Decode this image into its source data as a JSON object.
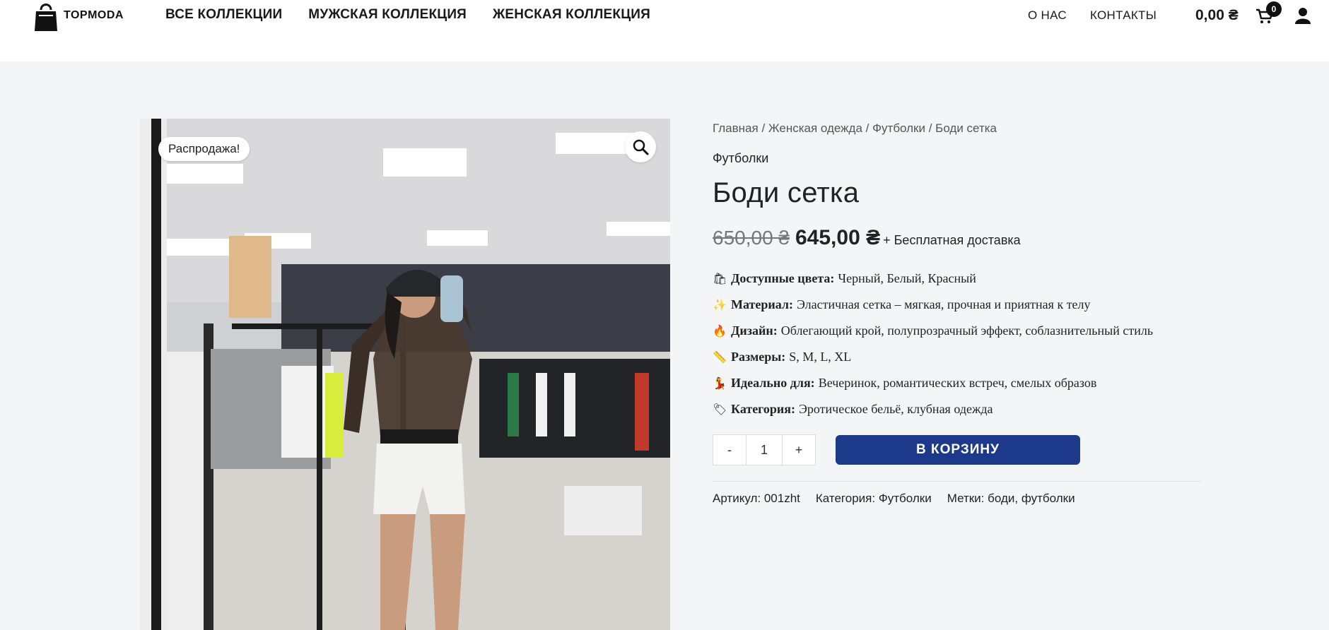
{
  "brand": {
    "name": "TOPMODA"
  },
  "nav": {
    "main": [
      "ВСЕ КОЛЛЕКЦИИ",
      "МУЖСКАЯ КОЛЛЕКЦИЯ",
      "ЖЕНСКАЯ КОЛЛЕКЦИЯ"
    ],
    "right": [
      "О НАС",
      "КОНТАКТЫ"
    ]
  },
  "cart": {
    "total": "0,00 ₴",
    "count": "0"
  },
  "product": {
    "sale_badge": "Распродажа!",
    "breadcrumb": [
      "Главная",
      "Женская одежда",
      "Футболки",
      "Боди сетка"
    ],
    "breadcrumb_sep": " / ",
    "category": "Футболки",
    "title": "Боди сетка",
    "old_price": "650,00 ₴",
    "new_price": "645,00 ₴",
    "shipping": "+ Бесплатная доставка",
    "attributes": [
      {
        "icon": "🛍",
        "label": "Доступные цвета:",
        "value": "Черный, Белый, Красный"
      },
      {
        "icon": "✨",
        "label": "Материал:",
        "value": "Эластичная сетка – мягкая, прочная и приятная к телу"
      },
      {
        "icon": "🔥",
        "label": "Дизайн:",
        "value": "Облегающий крой, полупрозрачный эффект, соблазнительный стиль"
      },
      {
        "icon": "📏",
        "label": "Размеры:",
        "value": "S, M, L, XL"
      },
      {
        "icon": "💃",
        "label": "Идеально для:",
        "value": "Вечеринок, романтических встреч, смелых образов"
      },
      {
        "icon": "🏷",
        "label": "Категория:",
        "value": "Эротическое бельё, клубная одежда"
      }
    ],
    "qty": {
      "minus": "-",
      "value": "1",
      "plus": "+"
    },
    "add_to_cart": "В КОРЗИНУ",
    "meta": {
      "sku_label": "Артикул:",
      "sku": "001zht",
      "cat_label": "Категория:",
      "cat": "Футболки",
      "tags_label": "Метки:",
      "tags": "боди, футболки"
    }
  },
  "colors": {
    "accent": "#1d3a8a",
    "background": "#f4f5f7"
  }
}
